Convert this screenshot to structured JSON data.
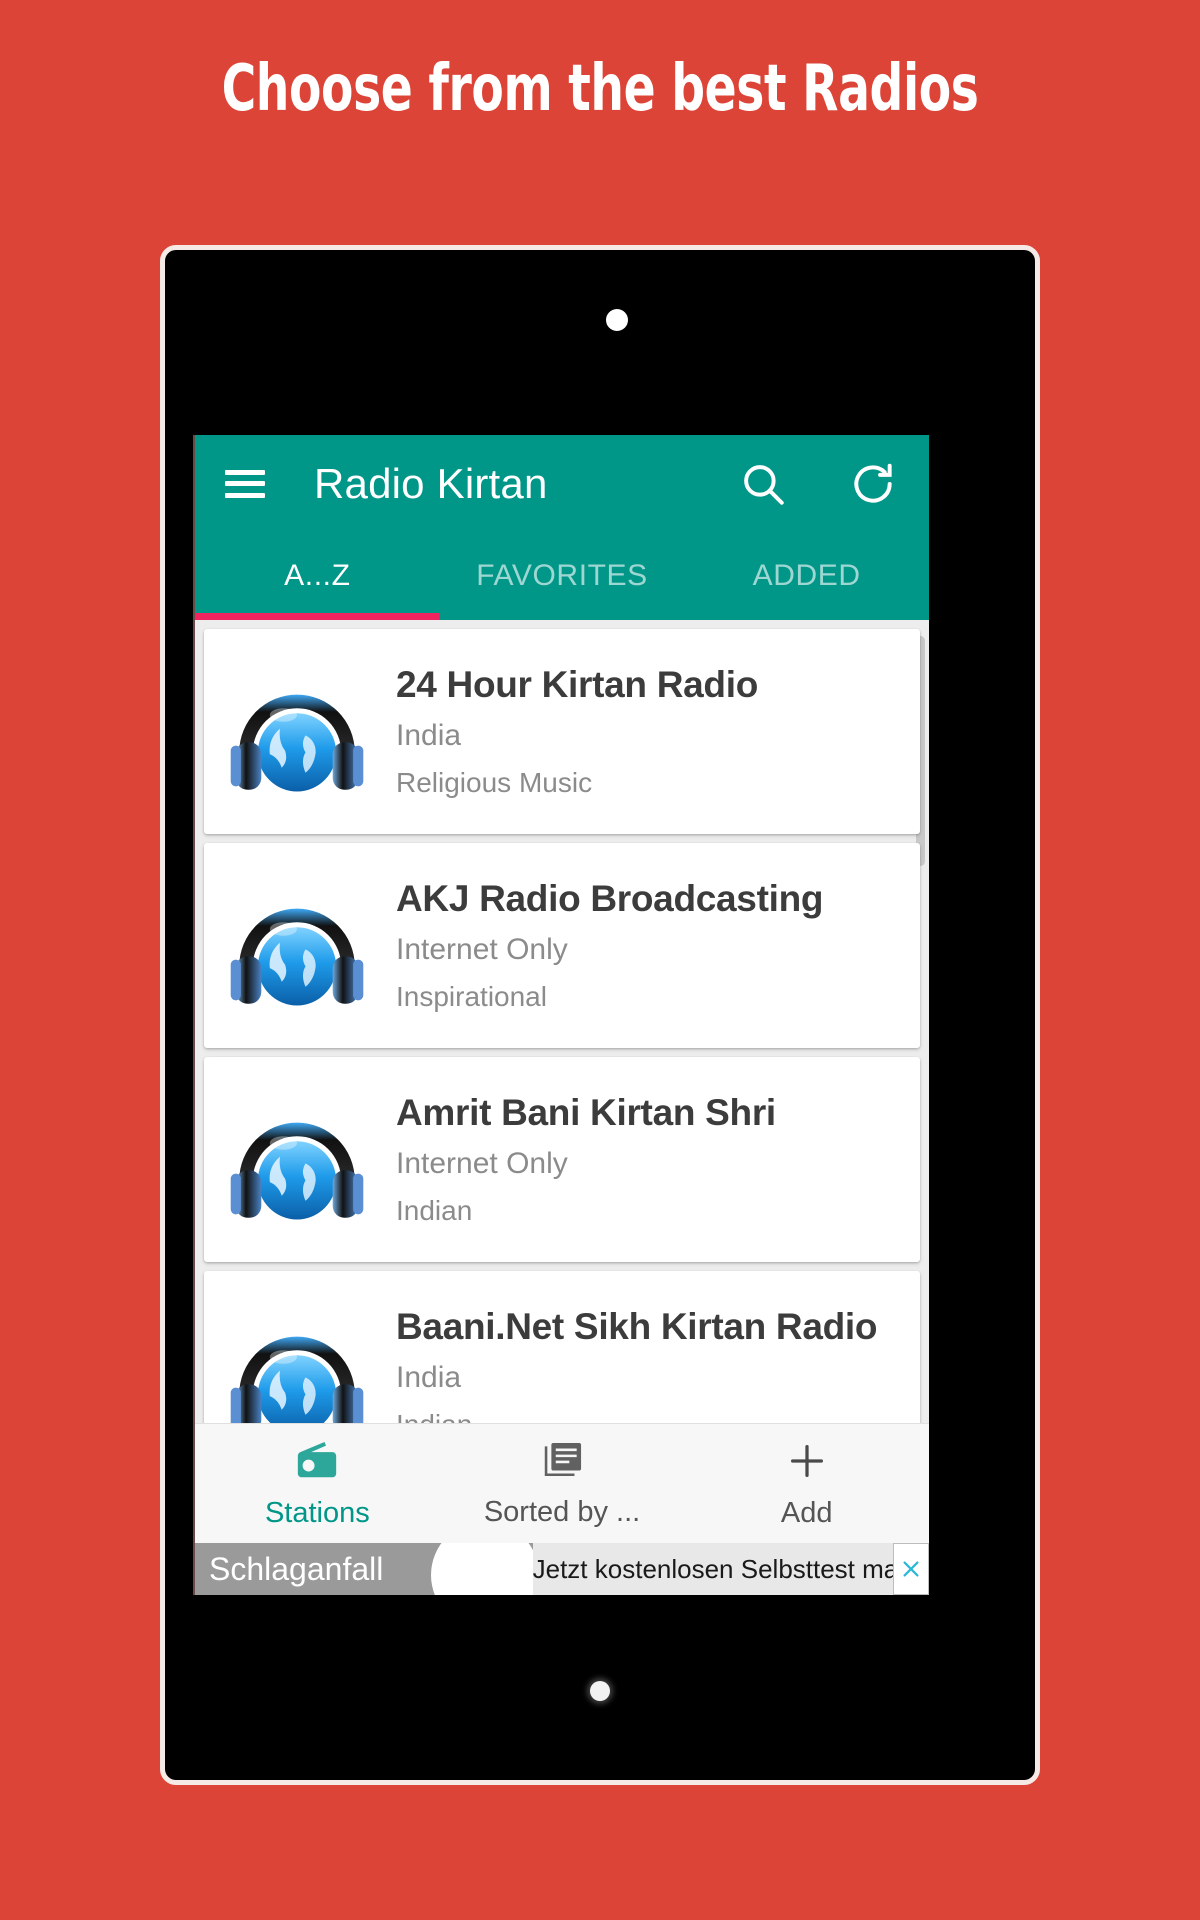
{
  "promo": {
    "headline": "Choose from the best Radios",
    "background_color": "#DC4437",
    "text_color": "#FFFFFF"
  },
  "app": {
    "accent_color": "#009688",
    "tab_indicator_color": "#F2245F",
    "appbar": {
      "menu_icon": "hamburger-menu-icon",
      "title": "Radio Kirtan",
      "actions": [
        {
          "icon": "search-icon",
          "label": "Search"
        },
        {
          "icon": "refresh-icon",
          "label": "Refresh"
        }
      ]
    },
    "tabs": [
      {
        "label": "A...Z",
        "active": true
      },
      {
        "label": "FAVORITES",
        "active": false
      },
      {
        "label": "ADDED",
        "active": false
      }
    ],
    "stations": [
      {
        "title": "24 Hour Kirtan Radio",
        "location": "India",
        "genre": "Religious Music",
        "icon": "headphones-globe-icon"
      },
      {
        "title": "AKJ Radio Broadcasting",
        "location": "Internet Only",
        "genre": "Inspirational",
        "icon": "headphones-globe-icon"
      },
      {
        "title": "Amrit Bani Kirtan Shri",
        "location": "Internet Only",
        "genre": "Indian",
        "icon": "headphones-globe-icon"
      },
      {
        "title": "Baani.Net Sikh Kirtan Radio",
        "location": "India",
        "genre": "Indian",
        "icon": "headphones-globe-icon"
      }
    ],
    "bottom_nav": [
      {
        "label": "Stations",
        "icon": "radio-icon",
        "active": true
      },
      {
        "label": "Sorted by ...",
        "icon": "article-list-icon",
        "active": false
      },
      {
        "label": "Add",
        "icon": "plus-icon",
        "active": false
      }
    ],
    "ad": {
      "left_text": "Schlaganfall",
      "right_text": "Jetzt kostenlosen Selbsttest machen",
      "close_icon": "close-x-icon",
      "close_color": "#2BB8D8"
    }
  }
}
